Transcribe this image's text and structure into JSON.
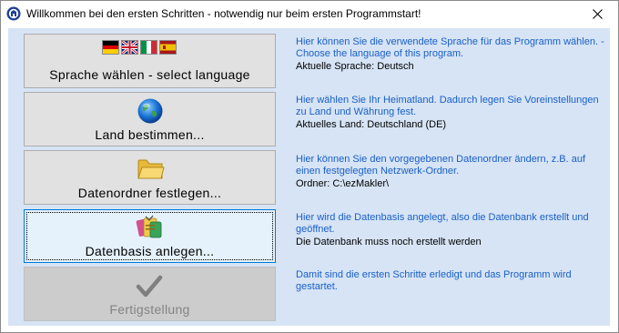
{
  "window": {
    "title": "Willkommen bei den ersten Schritten - notwendig nur beim ersten Programmstart!"
  },
  "steps": [
    {
      "button_label": "Sprache wählen - select language",
      "icon": "flags-icon",
      "description": "Hier können Sie die verwendete Sprache für das Programm wählen. - Choose the language of this program.",
      "status": "Aktuelle Sprache: Deutsch"
    },
    {
      "button_label": "Land bestimmen...",
      "icon": "globe-icon",
      "description": "Hier wählen Sie Ihr Heimatland. Dadurch legen Sie Voreinstellungen zu Land und Währung fest.",
      "status": "Aktuelles Land: Deutschland (DE)"
    },
    {
      "button_label": "Datenordner festlegen...",
      "icon": "folder-icon",
      "description": "Hier können Sie den vorgegebenen Datenordner ändern, z.B. auf einen festgelegten Netzwerk-Ordner.",
      "status": "Ordner: C:\\ezMakler\\"
    },
    {
      "button_label": "Datenbasis anlegen...",
      "icon": "database-icon",
      "description": "Hier wird die Datenbasis angelegt, also die Datenbank erstellt und geöffnet.",
      "status": "Die Datenbank muss noch erstellt werden"
    },
    {
      "button_label": "Fertigstellung",
      "icon": "checkmark-icon",
      "description": "Damit sind die ersten Schritte erledigt und das Programm wird gestartet.",
      "status": ""
    }
  ],
  "colors": {
    "client_background": "#d6e4f5",
    "info_text": "#1a5fc7",
    "focus_border": "#0078d7"
  }
}
